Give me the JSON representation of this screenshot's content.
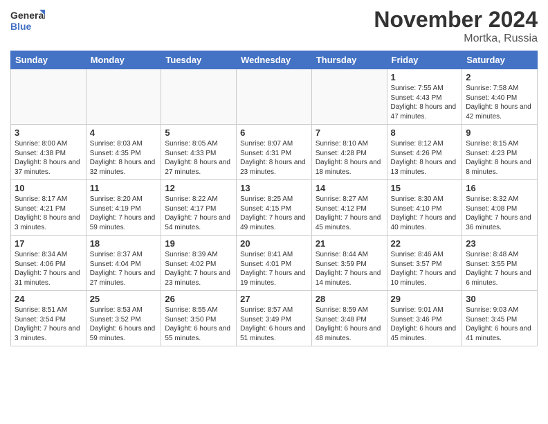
{
  "header": {
    "logo_general": "General",
    "logo_blue": "Blue",
    "month_title": "November 2024",
    "location": "Mortka, Russia"
  },
  "weekdays": [
    "Sunday",
    "Monday",
    "Tuesday",
    "Wednesday",
    "Thursday",
    "Friday",
    "Saturday"
  ],
  "weeks": [
    [
      {
        "day": "",
        "info": ""
      },
      {
        "day": "",
        "info": ""
      },
      {
        "day": "",
        "info": ""
      },
      {
        "day": "",
        "info": ""
      },
      {
        "day": "",
        "info": ""
      },
      {
        "day": "1",
        "info": "Sunrise: 7:55 AM\nSunset: 4:43 PM\nDaylight: 8 hours and 47 minutes."
      },
      {
        "day": "2",
        "info": "Sunrise: 7:58 AM\nSunset: 4:40 PM\nDaylight: 8 hours and 42 minutes."
      }
    ],
    [
      {
        "day": "3",
        "info": "Sunrise: 8:00 AM\nSunset: 4:38 PM\nDaylight: 8 hours and 37 minutes."
      },
      {
        "day": "4",
        "info": "Sunrise: 8:03 AM\nSunset: 4:35 PM\nDaylight: 8 hours and 32 minutes."
      },
      {
        "day": "5",
        "info": "Sunrise: 8:05 AM\nSunset: 4:33 PM\nDaylight: 8 hours and 27 minutes."
      },
      {
        "day": "6",
        "info": "Sunrise: 8:07 AM\nSunset: 4:31 PM\nDaylight: 8 hours and 23 minutes."
      },
      {
        "day": "7",
        "info": "Sunrise: 8:10 AM\nSunset: 4:28 PM\nDaylight: 8 hours and 18 minutes."
      },
      {
        "day": "8",
        "info": "Sunrise: 8:12 AM\nSunset: 4:26 PM\nDaylight: 8 hours and 13 minutes."
      },
      {
        "day": "9",
        "info": "Sunrise: 8:15 AM\nSunset: 4:23 PM\nDaylight: 8 hours and 8 minutes."
      }
    ],
    [
      {
        "day": "10",
        "info": "Sunrise: 8:17 AM\nSunset: 4:21 PM\nDaylight: 8 hours and 3 minutes."
      },
      {
        "day": "11",
        "info": "Sunrise: 8:20 AM\nSunset: 4:19 PM\nDaylight: 7 hours and 59 minutes."
      },
      {
        "day": "12",
        "info": "Sunrise: 8:22 AM\nSunset: 4:17 PM\nDaylight: 7 hours and 54 minutes."
      },
      {
        "day": "13",
        "info": "Sunrise: 8:25 AM\nSunset: 4:15 PM\nDaylight: 7 hours and 49 minutes."
      },
      {
        "day": "14",
        "info": "Sunrise: 8:27 AM\nSunset: 4:12 PM\nDaylight: 7 hours and 45 minutes."
      },
      {
        "day": "15",
        "info": "Sunrise: 8:30 AM\nSunset: 4:10 PM\nDaylight: 7 hours and 40 minutes."
      },
      {
        "day": "16",
        "info": "Sunrise: 8:32 AM\nSunset: 4:08 PM\nDaylight: 7 hours and 36 minutes."
      }
    ],
    [
      {
        "day": "17",
        "info": "Sunrise: 8:34 AM\nSunset: 4:06 PM\nDaylight: 7 hours and 31 minutes."
      },
      {
        "day": "18",
        "info": "Sunrise: 8:37 AM\nSunset: 4:04 PM\nDaylight: 7 hours and 27 minutes."
      },
      {
        "day": "19",
        "info": "Sunrise: 8:39 AM\nSunset: 4:02 PM\nDaylight: 7 hours and 23 minutes."
      },
      {
        "day": "20",
        "info": "Sunrise: 8:41 AM\nSunset: 4:01 PM\nDaylight: 7 hours and 19 minutes."
      },
      {
        "day": "21",
        "info": "Sunrise: 8:44 AM\nSunset: 3:59 PM\nDaylight: 7 hours and 14 minutes."
      },
      {
        "day": "22",
        "info": "Sunrise: 8:46 AM\nSunset: 3:57 PM\nDaylight: 7 hours and 10 minutes."
      },
      {
        "day": "23",
        "info": "Sunrise: 8:48 AM\nSunset: 3:55 PM\nDaylight: 7 hours and 6 minutes."
      }
    ],
    [
      {
        "day": "24",
        "info": "Sunrise: 8:51 AM\nSunset: 3:54 PM\nDaylight: 7 hours and 3 minutes."
      },
      {
        "day": "25",
        "info": "Sunrise: 8:53 AM\nSunset: 3:52 PM\nDaylight: 6 hours and 59 minutes."
      },
      {
        "day": "26",
        "info": "Sunrise: 8:55 AM\nSunset: 3:50 PM\nDaylight: 6 hours and 55 minutes."
      },
      {
        "day": "27",
        "info": "Sunrise: 8:57 AM\nSunset: 3:49 PM\nDaylight: 6 hours and 51 minutes."
      },
      {
        "day": "28",
        "info": "Sunrise: 8:59 AM\nSunset: 3:48 PM\nDaylight: 6 hours and 48 minutes."
      },
      {
        "day": "29",
        "info": "Sunrise: 9:01 AM\nSunset: 3:46 PM\nDaylight: 6 hours and 45 minutes."
      },
      {
        "day": "30",
        "info": "Sunrise: 9:03 AM\nSunset: 3:45 PM\nDaylight: 6 hours and 41 minutes."
      }
    ]
  ]
}
